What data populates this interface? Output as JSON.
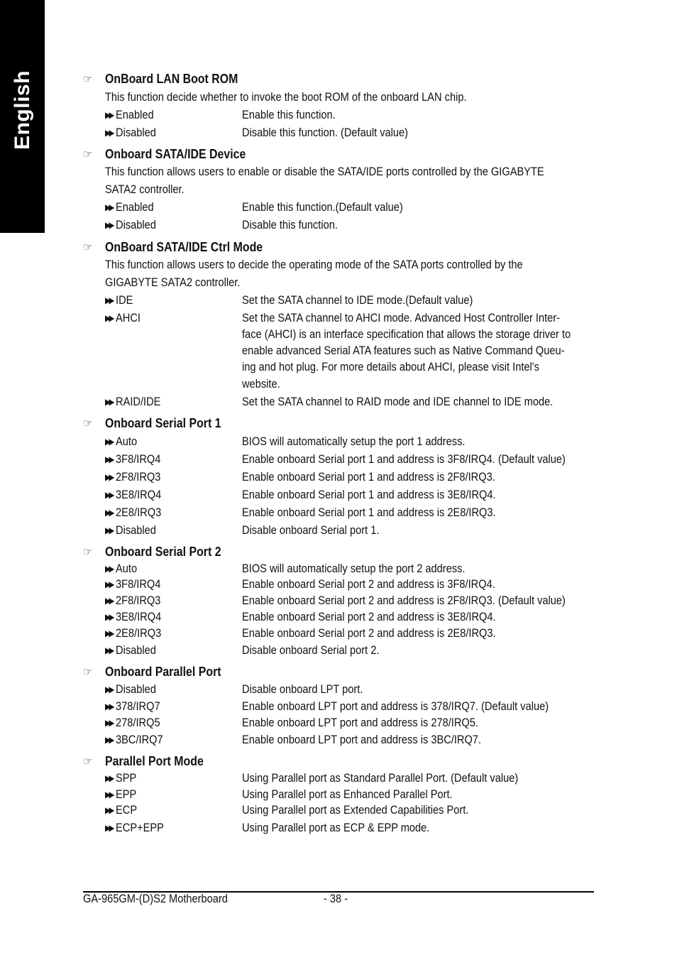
{
  "side_tab": {
    "label": "English"
  },
  "sections": [
    {
      "title": "OnBoard LAN Boot ROM",
      "description": [
        "This function decide whether to invoke the boot ROM of the onboard LAN chip."
      ],
      "options": [
        {
          "name": "Enabled",
          "desc": [
            "Enable this function."
          ]
        },
        {
          "name": "Disabled",
          "desc": [
            "Disable this function. (Default value)"
          ]
        }
      ]
    },
    {
      "title": "Onboard SATA/IDE Device",
      "description": [
        "This function allows users to enable or disable the SATA/IDE ports controlled by the GIGABYTE",
        "SATA2 controller."
      ],
      "options": [
        {
          "name": "Enabled",
          "desc": [
            "Enable this function.(Default value)"
          ]
        },
        {
          "name": "Disabled",
          "desc": [
            "Disable this function."
          ]
        }
      ]
    },
    {
      "title": "OnBoard SATA/IDE Ctrl Mode",
      "description": [
        "This function allows users to decide the operating mode of the SATA ports controlled by the",
        "GIGABYTE SATA2 controller."
      ],
      "options": [
        {
          "name": "IDE",
          "desc": [
            "Set the SATA channel to IDE mode.(Default value)"
          ]
        },
        {
          "name": "AHCI",
          "desc": [
            "Set the SATA channel to AHCI mode. Advanced Host Controller Inter-",
            "face (AHCI) is an interface specification that allows the storage driver to",
            "enable advanced Serial ATA features such as Native Command Queu-",
            "ing and hot plug. For more details about AHCI, please visit Intel's",
            "website."
          ]
        },
        {
          "name": "RAID/IDE",
          "desc": [
            "Set the SATA channel to RAID mode and IDE channel to IDE mode."
          ]
        }
      ]
    },
    {
      "title": "Onboard Serial Port 1",
      "description": [],
      "options": [
        {
          "name": "Auto",
          "desc": [
            "BIOS will automatically setup the port 1 address."
          ]
        },
        {
          "name": "3F8/IRQ4",
          "desc": [
            "Enable onboard Serial port 1 and address is 3F8/IRQ4. (Default value)"
          ]
        },
        {
          "name": "2F8/IRQ3",
          "desc": [
            "Enable onboard Serial port 1 and address is 2F8/IRQ3."
          ]
        },
        {
          "name": "3E8/IRQ4",
          "desc": [
            "Enable onboard Serial port 1 and address is 3E8/IRQ4."
          ]
        },
        {
          "name": "2E8/IRQ3",
          "desc": [
            "Enable onboard Serial port 1 and address is 2E8/IRQ3."
          ]
        },
        {
          "name": "Disabled",
          "desc": [
            "Disable onboard Serial port 1."
          ]
        }
      ]
    },
    {
      "title": "Onboard Serial Port 2",
      "description": [],
      "options": [
        {
          "name": "Auto",
          "desc": [
            "BIOS will automatically setup the port 2 address."
          ]
        },
        {
          "name": "3F8/IRQ4",
          "desc": [
            "Enable onboard Serial port 2 and address is 3F8/IRQ4."
          ]
        },
        {
          "name": "2F8/IRQ3",
          "desc": [
            "Enable onboard Serial port 2 and address is 2F8/IRQ3. (Default value)"
          ]
        },
        {
          "name": "3E8/IRQ4",
          "desc": [
            "Enable onboard Serial port 2 and address is 3E8/IRQ4."
          ]
        },
        {
          "name": "2E8/IRQ3",
          "desc": [
            "Enable onboard Serial port 2 and address is 2E8/IRQ3."
          ]
        },
        {
          "name": "Disabled",
          "desc": [
            "Disable onboard Serial port 2."
          ]
        }
      ]
    },
    {
      "title": "Onboard Parallel Port",
      "description": [],
      "options": [
        {
          "name": "Disabled",
          "desc": [
            "Disable onboard LPT port."
          ]
        },
        {
          "name": "378/IRQ7",
          "desc": [
            "Enable onboard LPT port and address is 378/IRQ7. (Default value)"
          ]
        },
        {
          "name": "278/IRQ5",
          "desc": [
            "Enable onboard LPT port and address is 278/IRQ5."
          ]
        },
        {
          "name": "3BC/IRQ7",
          "desc": [
            "Enable onboard LPT port and address is 3BC/IRQ7."
          ]
        }
      ]
    },
    {
      "title": "Parallel Port Mode",
      "description": [],
      "options": [
        {
          "name": "SPP",
          "desc": [
            "Using Parallel port as Standard Parallel Port. (Default value)"
          ]
        },
        {
          "name": "EPP",
          "desc": [
            "Using Parallel port as Enhanced Parallel Port."
          ]
        },
        {
          "name": "ECP",
          "desc": [
            "Using Parallel port as Extended Capabilities Port."
          ]
        },
        {
          "name": "ECP+EPP",
          "desc": [
            "Using Parallel port as ECP & EPP mode."
          ]
        }
      ]
    }
  ],
  "icons": {
    "section_bullet": "pointing-hand-icon",
    "option_bullet": "double-arrow-icon"
  },
  "footer": {
    "model": "GA-965GM-(D)S2 Motherboard",
    "page": "- 38 -"
  }
}
